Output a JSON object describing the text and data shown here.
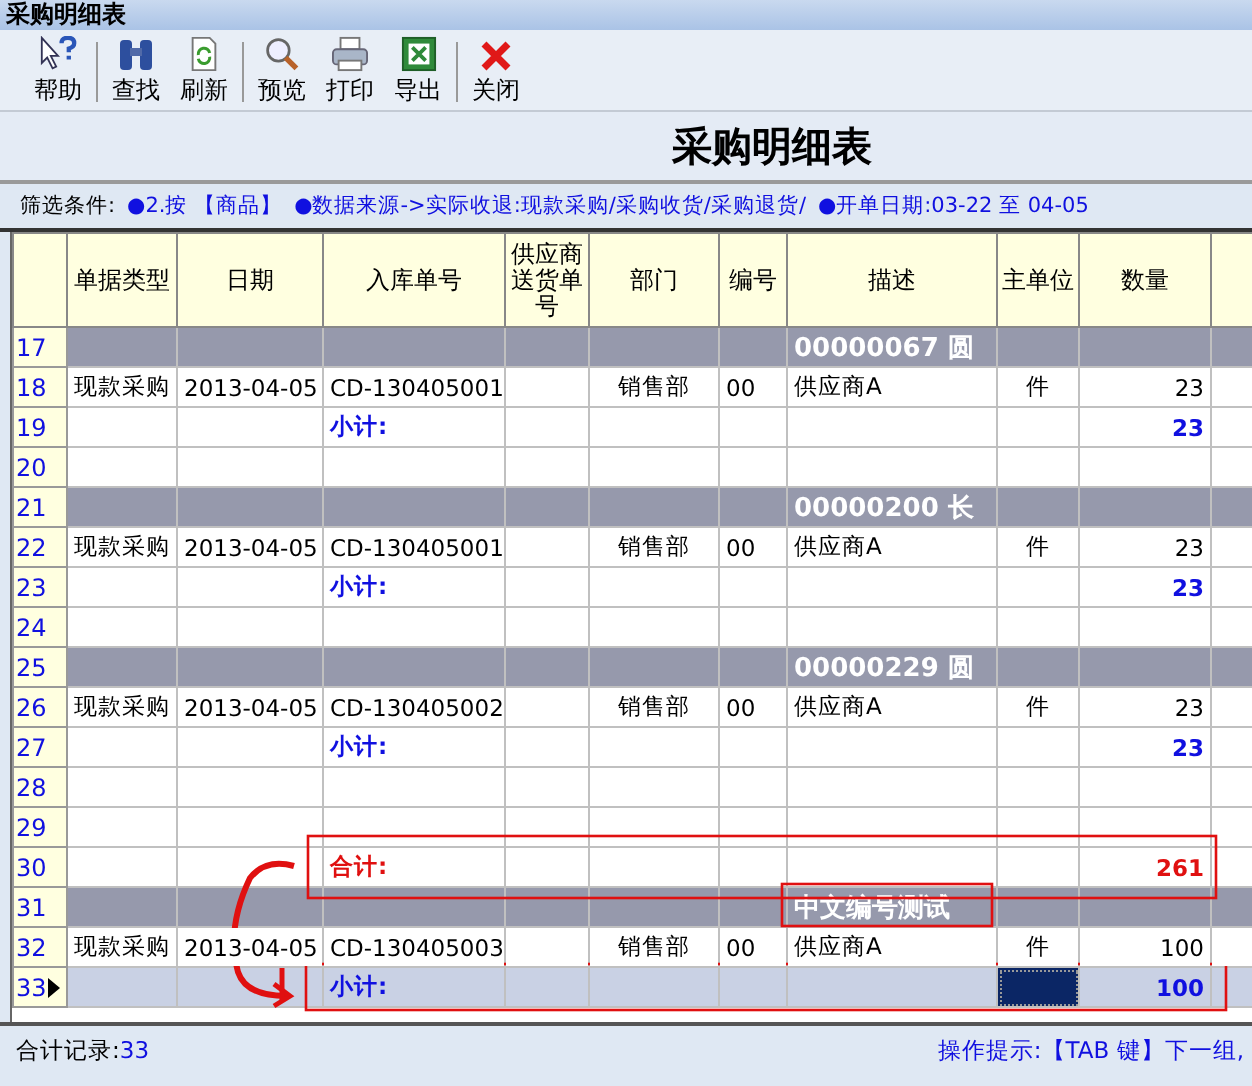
{
  "window": {
    "title": "采购明细表"
  },
  "toolbar": [
    {
      "label": "帮助"
    },
    {
      "label": "查找"
    },
    {
      "label": "刷新"
    },
    {
      "label": "预览"
    },
    {
      "label": "打印"
    },
    {
      "label": "导出"
    },
    {
      "label": "关闭"
    }
  ],
  "report_title": "采购明细表",
  "filter": {
    "label": "筛选条件:",
    "items": [
      "●2.按 【商品】",
      "●数据来源->实际收退:现款采购/采购收货/采购退货/",
      "●开单日期:03-22 至 04-05"
    ]
  },
  "table": {
    "columns": [
      "单据类型",
      "日期",
      "入库单号",
      "供应商送货单号",
      "部门",
      "编号",
      "描述",
      "主单位",
      "数量"
    ],
    "rows": [
      {
        "num": "17",
        "kind": "group",
        "selected": false,
        "title": "00000067 圆"
      },
      {
        "num": "18",
        "kind": "detail",
        "selected": false,
        "doc_type": "现款采购",
        "date": "2013-04-05",
        "receipt_no": "CD-130405001",
        "department": "销售部",
        "code": "00",
        "description": "供应商A",
        "unit": "件",
        "quantity": "23"
      },
      {
        "num": "19",
        "kind": "subtotal",
        "selected": false,
        "label": "小计:",
        "quantity": "23"
      },
      {
        "num": "20",
        "kind": "blank",
        "selected": false
      },
      {
        "num": "21",
        "kind": "group",
        "selected": false,
        "title": "00000200 长"
      },
      {
        "num": "22",
        "kind": "detail",
        "selected": false,
        "doc_type": "现款采购",
        "date": "2013-04-05",
        "receipt_no": "CD-130405001",
        "department": "销售部",
        "code": "00",
        "description": "供应商A",
        "unit": "件",
        "quantity": "23"
      },
      {
        "num": "23",
        "kind": "subtotal",
        "selected": false,
        "label": "小计:",
        "quantity": "23"
      },
      {
        "num": "24",
        "kind": "blank",
        "selected": false
      },
      {
        "num": "25",
        "kind": "group",
        "selected": false,
        "title": "00000229 圆"
      },
      {
        "num": "26",
        "kind": "detail",
        "selected": false,
        "doc_type": "现款采购",
        "date": "2013-04-05",
        "receipt_no": "CD-130405002",
        "department": "销售部",
        "code": "00",
        "description": "供应商A",
        "unit": "件",
        "quantity": "23"
      },
      {
        "num": "27",
        "kind": "subtotal",
        "selected": false,
        "label": "小计:",
        "quantity": "23"
      },
      {
        "num": "28",
        "kind": "blank",
        "selected": false
      },
      {
        "num": "29",
        "kind": "blank",
        "selected": false
      },
      {
        "num": "30",
        "kind": "total",
        "selected": false,
        "label": "合计:",
        "quantity": "261"
      },
      {
        "num": "31",
        "kind": "group",
        "selected": false,
        "title": "中文编号测试"
      },
      {
        "num": "32",
        "kind": "detail",
        "selected": false,
        "doc_type": "现款采购",
        "date": "2013-04-05",
        "receipt_no": "CD-130405003",
        "department": "销售部",
        "code": "00",
        "description": "供应商A",
        "unit": "件",
        "quantity": "100"
      },
      {
        "num": "33",
        "kind": "subtotal",
        "selected": true,
        "label": "小计:",
        "quantity": "100"
      }
    ]
  },
  "status_bar": {
    "label": "合计记录:",
    "count": "33",
    "hint": "操作提示:【TAB 键】下一组,"
  }
}
